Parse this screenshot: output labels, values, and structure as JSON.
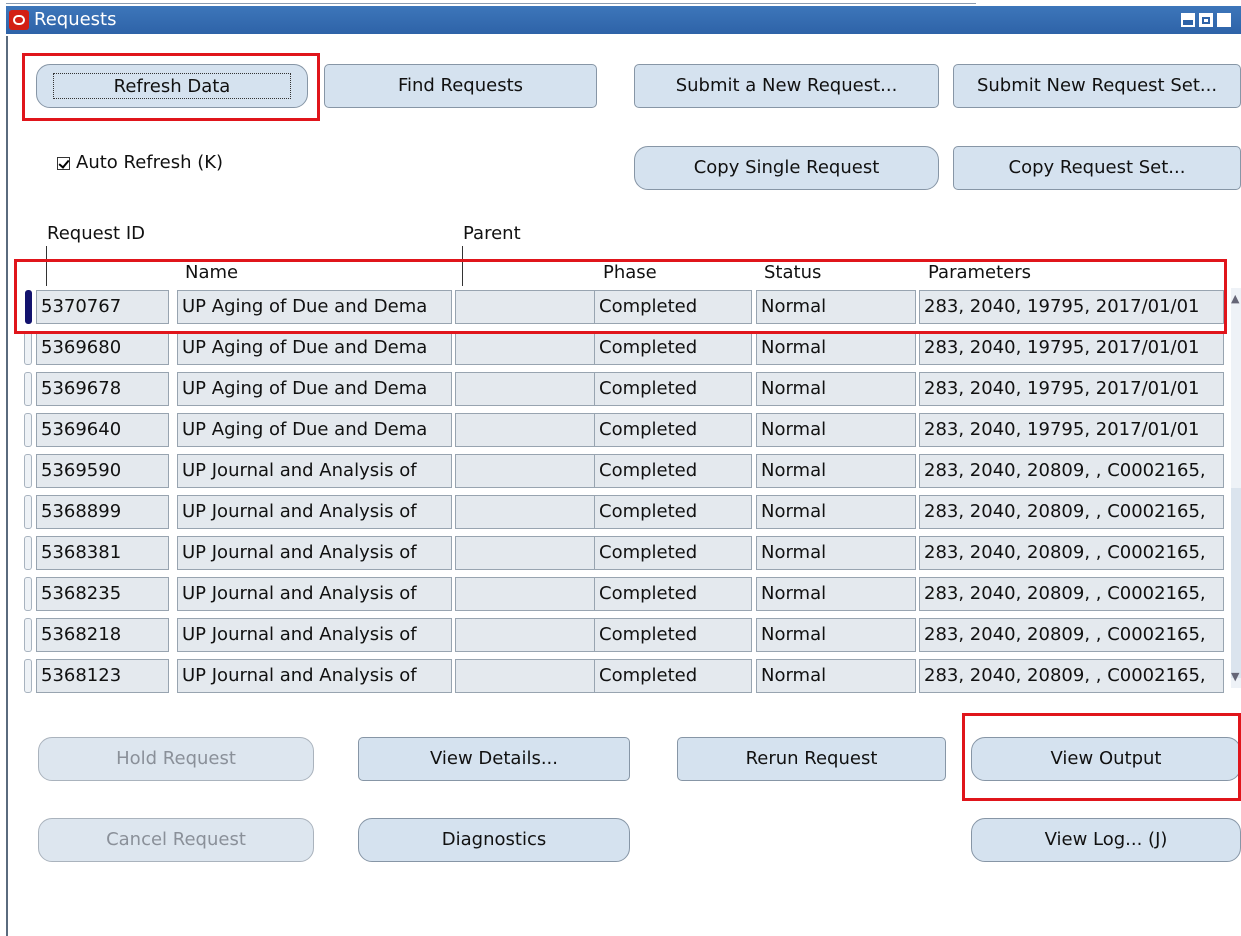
{
  "window": {
    "title": "Requests"
  },
  "buttons": {
    "refresh": "Refresh Data",
    "find": "Find Requests",
    "submit_new": "Submit a New Request...",
    "submit_set": "Submit New Request Set...",
    "copy_single": "Copy Single Request",
    "copy_set": "Copy Request Set...",
    "hold": "Hold Request",
    "view_details": "View Details...",
    "rerun": "Rerun Request",
    "view_output": "View Output",
    "cancel": "Cancel Request",
    "diagnostics": "Diagnostics",
    "view_log": "View Log... (J)"
  },
  "auto_refresh": {
    "label": "Auto Refresh (K)",
    "checked": true
  },
  "table": {
    "headers": {
      "request_id": "Request ID",
      "parent": "Parent",
      "name": "Name",
      "phase": "Phase",
      "status": "Status",
      "parameters": "Parameters"
    },
    "rows": [
      {
        "id": "5370767",
        "name": "UP Aging of Due and Dema",
        "parent": "",
        "phase": "Completed",
        "status": "Normal",
        "params": "283, 2040, 19795, 2017/01/01"
      },
      {
        "id": "5369680",
        "name": "UP Aging of Due and Dema",
        "parent": "",
        "phase": "Completed",
        "status": "Normal",
        "params": "283, 2040, 19795, 2017/01/01"
      },
      {
        "id": "5369678",
        "name": "UP Aging of Due and Dema",
        "parent": "",
        "phase": "Completed",
        "status": "Normal",
        "params": "283, 2040, 19795, 2017/01/01"
      },
      {
        "id": "5369640",
        "name": "UP Aging of Due and Dema",
        "parent": "",
        "phase": "Completed",
        "status": "Normal",
        "params": "283, 2040, 19795, 2017/01/01"
      },
      {
        "id": "5369590",
        "name": "UP Journal and Analysis of",
        "parent": "",
        "phase": "Completed",
        "status": "Normal",
        "params": "283, 2040, 20809, , C0002165,"
      },
      {
        "id": "5368899",
        "name": "UP Journal and Analysis of",
        "parent": "",
        "phase": "Completed",
        "status": "Normal",
        "params": "283, 2040, 20809, , C0002165,"
      },
      {
        "id": "5368381",
        "name": "UP Journal and Analysis of",
        "parent": "",
        "phase": "Completed",
        "status": "Normal",
        "params": "283, 2040, 20809, , C0002165,"
      },
      {
        "id": "5368235",
        "name": "UP Journal and Analysis of",
        "parent": "",
        "phase": "Completed",
        "status": "Normal",
        "params": "283, 2040, 20809, , C0002165,"
      },
      {
        "id": "5368218",
        "name": "UP Journal and Analysis of",
        "parent": "",
        "phase": "Completed",
        "status": "Normal",
        "params": "283, 2040, 20809, , C0002165,"
      },
      {
        "id": "5368123",
        "name": "UP Journal and Analysis of",
        "parent": "",
        "phase": "Completed",
        "status": "Normal",
        "params": "283, 2040, 20809, , C0002165,"
      }
    ]
  },
  "colors": {
    "titlebar": "#2e63a8",
    "button_bg": "#d5e2ef",
    "annotation": "#e0151b",
    "current_row_marker": "#13136e"
  }
}
